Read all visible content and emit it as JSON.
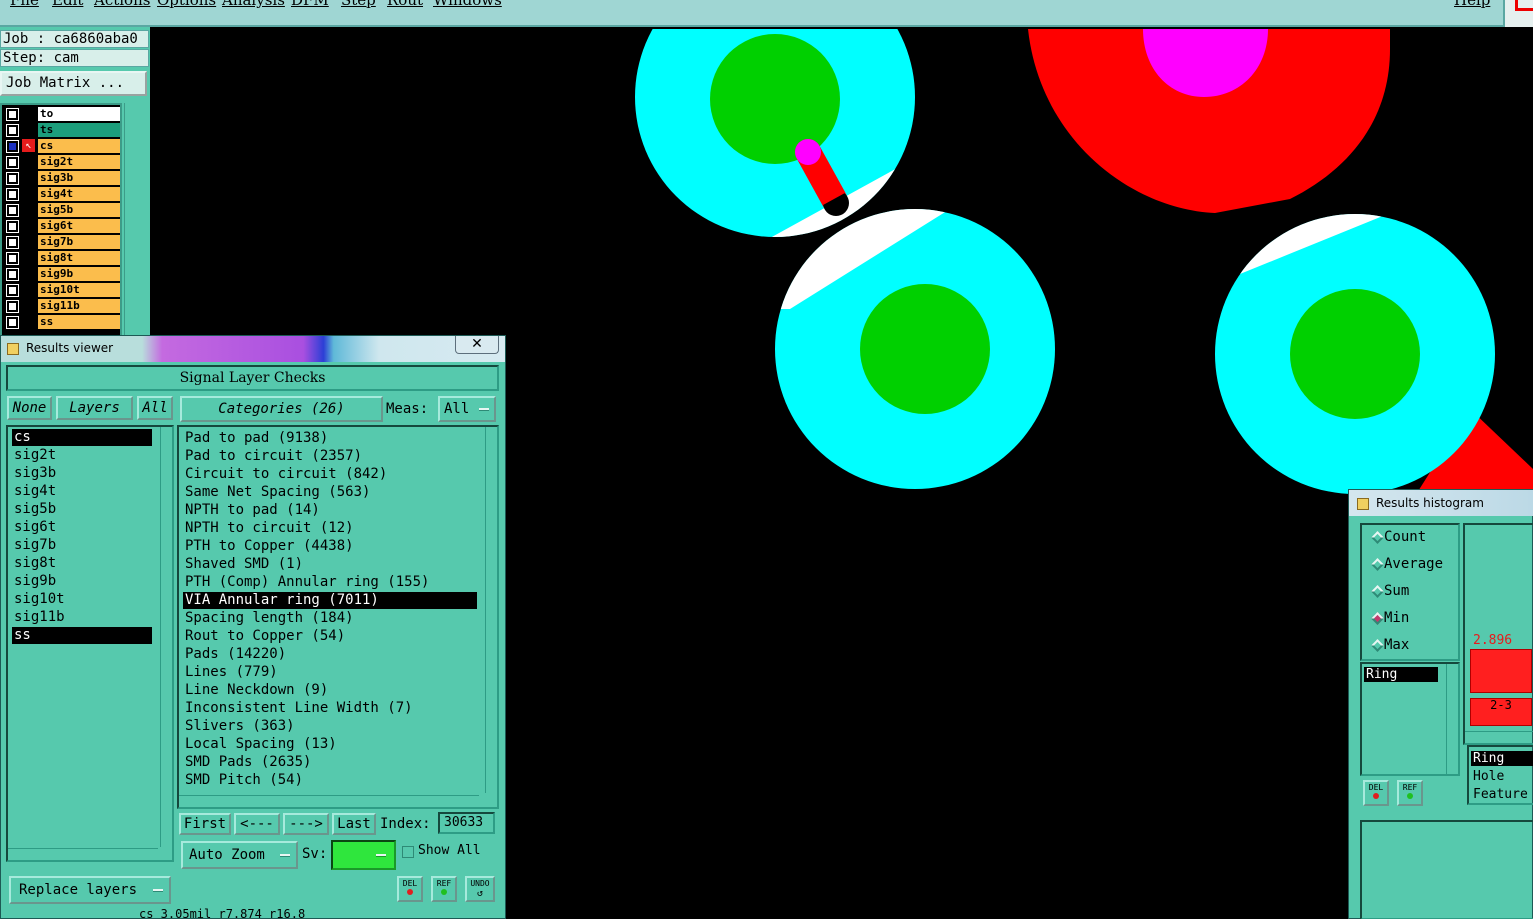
{
  "menubar": {
    "items": [
      "File",
      "Edit",
      "Actions",
      "Options",
      "Analysis",
      "DFM",
      "Step",
      "Rout",
      "Windows"
    ],
    "help": "Help"
  },
  "left_panel": {
    "job_label": "Job : ca6860aba0",
    "step_label": "Step: cam",
    "job_matrix_button": "Job Matrix ...",
    "layers": [
      "to",
      "ts",
      "cs",
      "sig2t",
      "sig3b",
      "sig4t",
      "sig5b",
      "sig6t",
      "sig7b",
      "sig8t",
      "sig9b",
      "sig10t",
      "sig11b",
      "ss"
    ]
  },
  "results_viewer": {
    "title": "Results viewer",
    "close_label": "✕",
    "header": "Signal Layer Checks",
    "none_button": "None",
    "layers_button": "Layers",
    "all_button": "All",
    "categories_button": "Categories (26)",
    "meas_label": "Meas:",
    "meas_value": "All",
    "layer_list": [
      "cs",
      "sig2t",
      "sig3b",
      "sig4t",
      "sig5b",
      "sig6t",
      "sig7b",
      "sig8t",
      "sig9b",
      "sig10t",
      "sig11b",
      "ss"
    ],
    "categories": [
      "Pad to pad (9138)",
      "Pad to circuit (2357)",
      "Circuit to circuit (842)",
      "Same Net Spacing (563)",
      "NPTH to pad (14)",
      "NPTH to circuit (12)",
      "PTH to Copper (4438)",
      "Shaved SMD (1)",
      "PTH (Comp) Annular ring (155)",
      "VIA Annular ring (7011)",
      "Spacing length (184)",
      "Rout to Copper (54)",
      "Pads (14220)",
      "Lines (779)",
      "Line Neckdown (9)",
      "Inconsistent Line Width (7)",
      "Slivers (363)",
      "Local Spacing (13)",
      "SMD Pads (2635)",
      "SMD Pitch (54)"
    ],
    "selected_category": "VIA Annular ring (7011)",
    "nav": {
      "first": "First",
      "prev": "<---",
      "next": "--->",
      "last": "Last",
      "index_label": "Index:",
      "index_value": "30633"
    },
    "auto_zoom": "Auto Zoom",
    "sv_label": "Sv:",
    "show_all": "Show All",
    "replace_layers": "Replace layers",
    "icon_buttons": [
      "DEL",
      "REF",
      "UNDO"
    ],
    "status": "cs 3.05mil  r7.874  r16.8"
  },
  "histogram": {
    "title": "Results histogram",
    "modes": [
      "Count",
      "Average",
      "Sum",
      "Min",
      "Max"
    ],
    "selected_mode": "Min",
    "list": [
      "Ring"
    ],
    "bar_label": "2.896",
    "bin_label": "2-3",
    "fields": [
      "Ring",
      "Hole",
      "Feature"
    ],
    "icon_buttons": [
      "DEL",
      "REF"
    ]
  },
  "colors": {
    "background": "#000000",
    "panel": "#56c9ad",
    "pad": "#00ffff",
    "drill": "#00d000",
    "track": "#ff0000",
    "marker": "#ff00ff",
    "layer_active": "#fbbd4c"
  }
}
